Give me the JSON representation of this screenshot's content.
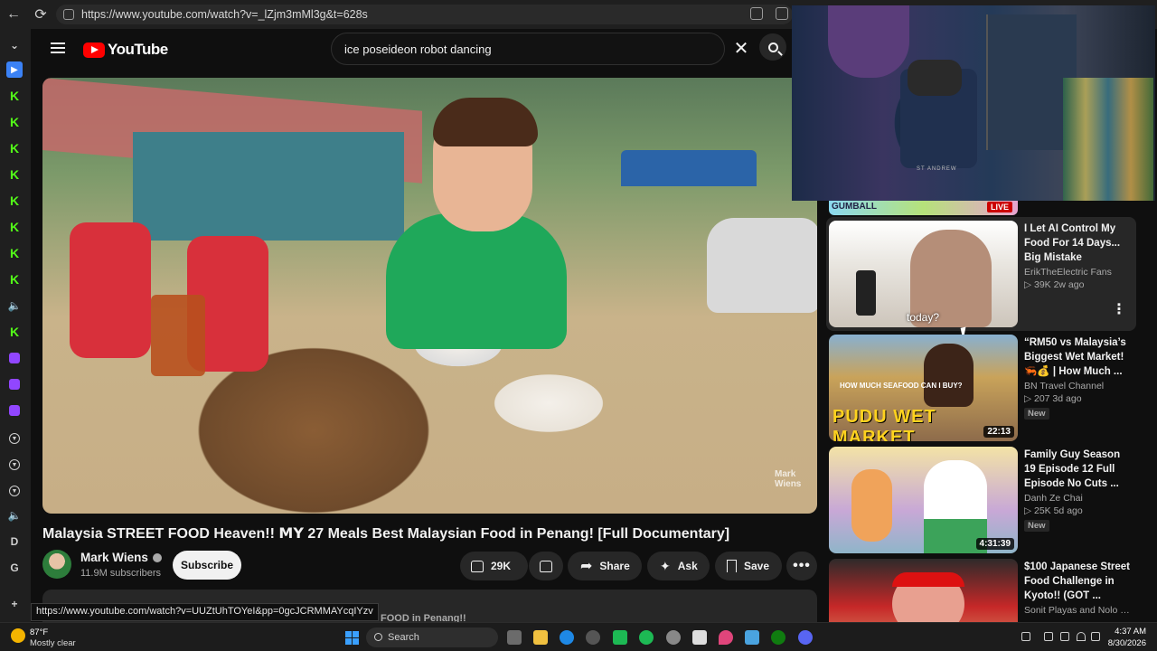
{
  "browser": {
    "url": "https://www.youtube.com/watch?v=_lZjm3mMl3g&t=628s",
    "status_url": "https://www.youtube.com/watch?v=UUZtUhTOYeI&pp=0gcJCRMMAYcqIYzv"
  },
  "header": {
    "logo_text": "YouTube",
    "search_value": "ice poseideon robot dancing"
  },
  "video": {
    "title": "Malaysia STREET FOOD Heaven!! 𝗠𝗬 27 Meals Best Malaysian Food in Penang! [Full Documentary]",
    "watermark": "Mark Wiens",
    "channel_name": "Mark Wiens",
    "subscribers": "11.9M subscribers",
    "subscribe_label": "Subscribe",
    "likes": "29K",
    "share_label": "Share",
    "ask_label": "Ask",
    "save_label": "Save",
    "description_peek": "FOOD in Penang!!"
  },
  "webcam": {
    "shirt_text": "ST ANDREW"
  },
  "live_strip": {
    "label": "GUMBALL",
    "badge": "LIVE"
  },
  "recommendations": [
    {
      "title": "I Let AI Control My Food For 14 Days... Big Mistake",
      "channel": "ErikTheElectric Fans",
      "meta": "▷ 39K  2w ago",
      "caption": "today?",
      "duration": "",
      "badge": ""
    },
    {
      "title": "“RM50 vs Malaysia’s Biggest Wet Market! 🦐💰 | How Much ...",
      "channel": "BN Travel Channel",
      "meta": "▷ 207  3d ago",
      "thumb_text": "PUDU WET MARKET",
      "thumb_question": "HOW MUCH SEAFOOD CAN I BUY?",
      "duration": "22:13",
      "badge": "New"
    },
    {
      "title": "Family Guy Season 19 Episode 12 Full Episode No Cuts ...",
      "channel": "Danh Ze Chai",
      "meta": "▷ 25K  5d ago",
      "duration": "4:31:39",
      "badge": "New"
    },
    {
      "title": "$100 Japanese Street Food Challenge in Kyoto!! (GOT ...",
      "channel": "Sonit Playas and Nolo Gm...",
      "meta": "",
      "duration": "",
      "badge": ""
    }
  ],
  "taskbar": {
    "temp": "87°F",
    "weather": "Mostly clear",
    "search_label": "Search",
    "time": "4:37 AM",
    "date": "8/30/2026"
  }
}
